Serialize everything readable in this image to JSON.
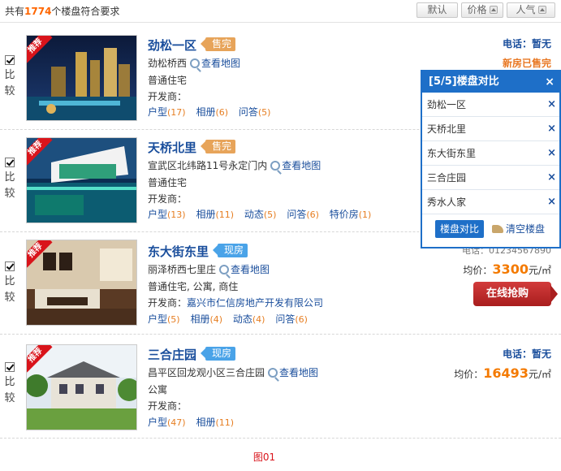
{
  "header": {
    "count_prefix": "共有",
    "count": "1774",
    "count_suffix": "个楼盘符合要求",
    "sort_default": "默认",
    "sort_price": "价格",
    "sort_popularity": "人气"
  },
  "listings": [
    {
      "name": "劲松一区",
      "status_tag": "售完",
      "address": "劲松桥西",
      "map_link": "查看地图",
      "type": "普通住宅",
      "developer_label": "开发商：",
      "developer": "",
      "links": [
        {
          "label": "户型",
          "count": "(17)"
        },
        {
          "label": "相册",
          "count": "(6)"
        },
        {
          "label": "问答",
          "count": "(5)"
        }
      ],
      "phone": "电话：暂无",
      "sold_text": "新房已售完",
      "compare_label": "比较",
      "badge": "推荐"
    },
    {
      "name": "天桥北里",
      "status_tag": "售完",
      "address": "宣武区北纬路11号永定门内",
      "map_link": "查看地图",
      "type": "普通住宅",
      "developer_label": "开发商：",
      "developer": "",
      "links": [
        {
          "label": "户型",
          "count": "(13)"
        },
        {
          "label": "相册",
          "count": "(11)"
        },
        {
          "label": "动态",
          "count": "(5)"
        },
        {
          "label": "问答",
          "count": "(6)"
        },
        {
          "label": "特价房",
          "count": "(1)"
        }
      ],
      "compare_label": "比较",
      "badge": "推荐"
    },
    {
      "name": "东大街东里",
      "status_tag": "现房",
      "address": "丽泽桥西七里庄",
      "map_link": "查看地图",
      "type": "普通住宅, 公寓, 商住",
      "developer_label": "开发商：",
      "developer": "嘉兴市仁信房地产开发有限公司",
      "links": [
        {
          "label": "户型",
          "count": "(5)"
        },
        {
          "label": "相册",
          "count": "(4)"
        },
        {
          "label": "动态",
          "count": "(4)"
        },
        {
          "label": "问答",
          "count": "(6)"
        }
      ],
      "phone_partial": "电话：01234567890",
      "price_label": "均价：",
      "price": "3300",
      "price_unit": "元/㎡",
      "buy_button": "在线抢购",
      "compare_label": "比较",
      "badge": "推荐"
    },
    {
      "name": "三合庄园",
      "status_tag": "现房",
      "address": "昌平区回龙观小区三合庄园",
      "map_link": "查看地图",
      "type": "公寓",
      "developer_label": "开发商：",
      "developer": "",
      "links": [
        {
          "label": "户型",
          "count": "(47)"
        },
        {
          "label": "相册",
          "count": "(11)"
        }
      ],
      "phone": "电话：暂无",
      "price_label": "均价：",
      "price": "16493",
      "price_unit": "元/㎡",
      "compare_label": "比较",
      "badge": "推荐"
    }
  ],
  "compare_panel": {
    "title": "[5/5]楼盘对比",
    "close": "×",
    "items": [
      "劲松一区",
      "天桥北里",
      "东大街东里",
      "三合庄园",
      "秀水人家"
    ],
    "remove": "×",
    "compare_button": "楼盘对比",
    "clear_button": "清空楼盘"
  },
  "caption": "图01",
  "colors": {
    "link_blue": "#1a4e9c",
    "accent_orange": "#f47a00",
    "panel_blue": "#1e6fc8",
    "badge_red": "#d9141b"
  }
}
